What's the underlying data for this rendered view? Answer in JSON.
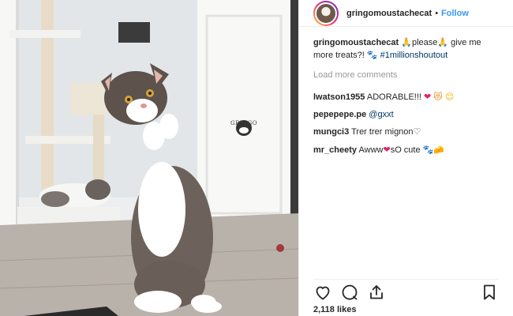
{
  "post": {
    "username": "gringomoustachecat",
    "separator": "•",
    "follow_label": "Follow",
    "watermark": "GRINGO",
    "caption": {
      "user": "gringomoustachecat",
      "text_a": " ",
      "emoji_a": "🙏",
      "text_b": "please",
      "emoji_b": "🙏",
      "text_c": " give me more treats?! ",
      "emoji_c": "🐾",
      "hashtag": " #1millionshoutout"
    },
    "load_more_label": "Load more comments",
    "comments": [
      {
        "user": "lwatson1955",
        "text": " ADORABLE!!! ",
        "emojis": [
          "❤",
          "😻",
          "😊"
        ]
      },
      {
        "user": "pepepepe.pe",
        "text": " @gxxt",
        "emojis": []
      },
      {
        "user": "mungci3",
        "text": " Trer trer mignon♡",
        "emojis": []
      },
      {
        "user": "mr_cheety",
        "text": " Awww",
        "heart": "❤",
        "text2": "sO cute",
        "emojis": [
          "🐾",
          "🧀"
        ]
      }
    ],
    "likes_label": "2,118 likes"
  },
  "icons": {
    "like": "heart-outline-icon",
    "comment": "speech-bubble-icon",
    "share": "share-icon",
    "save": "bookmark-icon"
  },
  "colors": {
    "accent_link": "#3897f0",
    "hashtag": "#003569",
    "muted": "#999999",
    "text": "#262626",
    "heart": "#e0245e"
  }
}
